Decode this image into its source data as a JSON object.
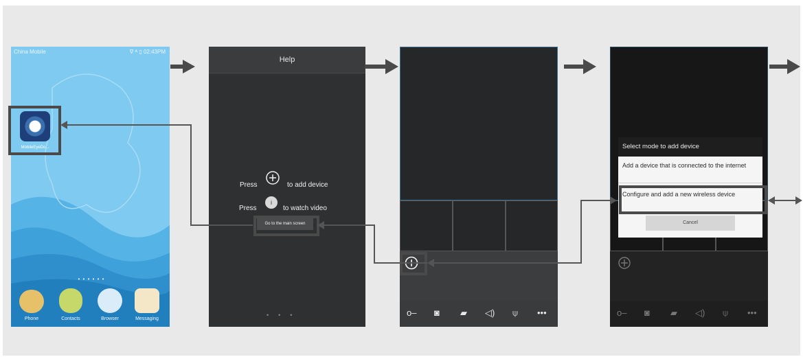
{
  "screen1": {
    "carrier": "China Mobile",
    "status_right": "∇ ᴬ ▯ 02:43PM",
    "app_label": "MobileEyeDo...",
    "dock": [
      "Phone",
      "Contacts",
      "Browser",
      "Messaging"
    ]
  },
  "screen2": {
    "header_title": "Help",
    "press_label_1": "Press",
    "add_device_text": "to add device",
    "press_label_2": "Press",
    "watch_video_text": "to watch video",
    "goto_button": "Go to the main screen",
    "info_icon_text": "i"
  },
  "screen3": {
    "add_icon": "plus-circle-icon",
    "toolbar_more": "•••"
  },
  "screen4": {
    "dialog_title": "Select mode to add device",
    "option1": "Add a device that is connected to the internet",
    "option2": "Configure and add a new wireless device",
    "cancel": "Cancel",
    "toolbar_more": "•••"
  },
  "colors": {
    "sky": "#76c6ee",
    "dark_screen": "#2f3031",
    "highlight_border": "#4a4a4a",
    "arrow": "#3b3b3b"
  }
}
